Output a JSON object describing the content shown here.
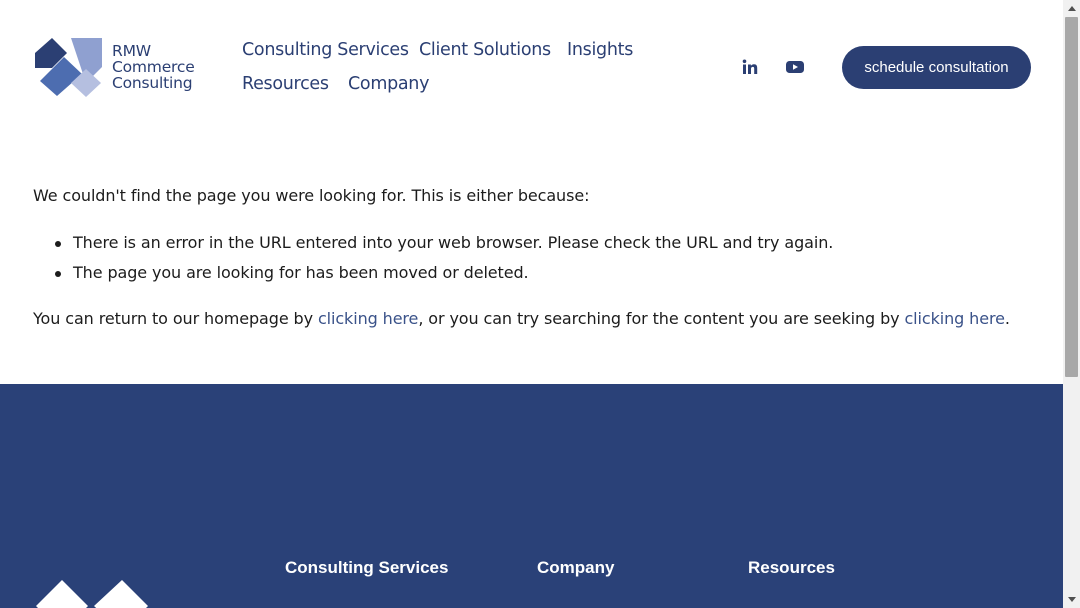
{
  "header": {
    "logo": {
      "line1": "RMW",
      "line2": "Commerce",
      "line3": "Consulting"
    },
    "nav": [
      {
        "label": "Consulting Services"
      },
      {
        "label": "Client Solutions"
      },
      {
        "label": "Insights"
      },
      {
        "label": "Resources"
      },
      {
        "label": "Company"
      }
    ],
    "social": [
      {
        "icon": "linkedin-icon"
      },
      {
        "icon": "youtube-icon"
      }
    ],
    "cta_label": "schedule consultation"
  },
  "content": {
    "intro": "We couldn't find the page you were looking for. This is either because:",
    "reasons": [
      "There is an error in the URL entered into your web browser. Please check the URL and try again.",
      "The page you are looking for has been moved or deleted."
    ],
    "return_prefix": "You can return to our homepage by ",
    "link1": "clicking here",
    "return_middle": ", or you can try searching for the content you are seeking by ",
    "link2": "clicking here",
    "return_suffix": "."
  },
  "footer": {
    "headings": [
      "Consulting Services",
      "Company",
      "Resources"
    ]
  },
  "colors": {
    "brand_navy": "#2b3f73",
    "footer_bg": "#2a4178",
    "logo_light": "#8fa0d0",
    "logo_mid": "#4d6db0"
  }
}
